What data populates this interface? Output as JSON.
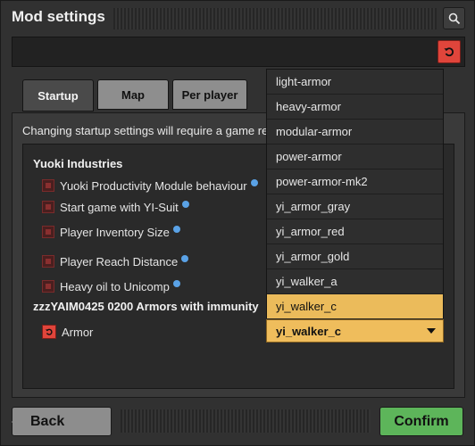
{
  "window": {
    "title": "Mod settings"
  },
  "tabs": [
    {
      "label": "Startup",
      "active": true
    },
    {
      "label": "Map",
      "active": false
    },
    {
      "label": "Per player",
      "active": false
    }
  ],
  "notice": "Changing startup settings will require a game re",
  "groups": [
    {
      "title": "Yuoki Industries",
      "settings": [
        {
          "label": "Yuoki Productivity Module behaviour"
        },
        {
          "label": "Start game with YI-Suit"
        },
        {
          "label": "Player Inventory Size"
        },
        {
          "label": "Player Reach Distance"
        },
        {
          "label": "Heavy oil to Unicomp"
        }
      ]
    },
    {
      "title": "zzzYAIM0425 0200 Armors with immunity",
      "settings": [
        {
          "label": "Armor"
        }
      ]
    }
  ],
  "dropdown": {
    "options": [
      "light-armor",
      "heavy-armor",
      "modular-armor",
      "power-armor",
      "power-armor-mk2",
      "yi_armor_gray",
      "yi_armor_red",
      "yi_armor_gold",
      "yi_walker_a",
      "yi_walker_c"
    ],
    "selected": "yi_walker_c"
  },
  "footer": {
    "back_label": "Back",
    "confirm_label": "Confirm"
  },
  "colors": {
    "accent_orange": "#efbd5c",
    "confirm_green": "#5db55a",
    "reset_red": "#e0453b",
    "info_blue": "#5aa2e6"
  },
  "icons": {
    "search": "search-icon",
    "reset": "reset-icon",
    "info": "info-icon",
    "dropdown_arrow": "chevron-down-icon"
  }
}
